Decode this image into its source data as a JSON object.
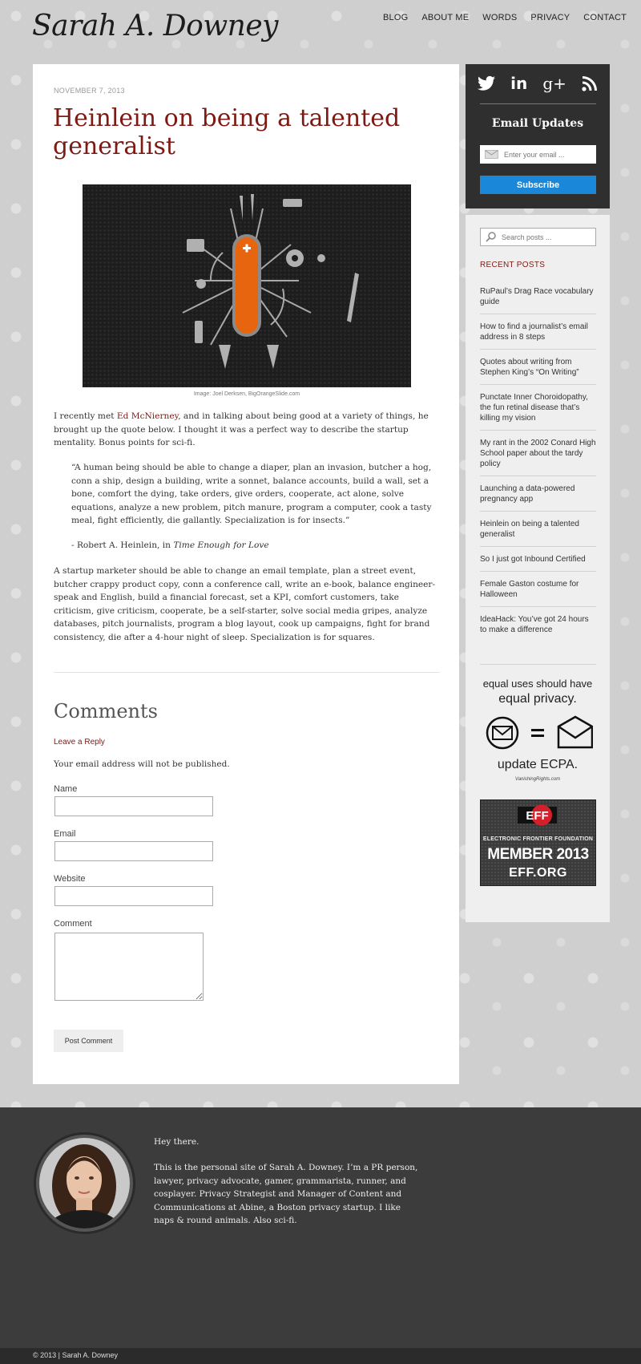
{
  "site": {
    "logo": "Sarah A. Downey"
  },
  "nav": {
    "items": [
      "BLOG",
      "ABOUT ME",
      "WORDS",
      "PRIVACY",
      "CONTACT"
    ]
  },
  "post": {
    "date": "NOVEMBER 7, 2013",
    "title": "Heinlein on being a talented generalist",
    "image_caption": "Image: Joel Derksen, BigOrangeSlide.com",
    "p1_before": "I recently met ",
    "p1_link": "Ed McNierney",
    "p1_after": ", and in talking about being good at a variety of things, he brought up the quote below. I thought it was a perfect way to describe the startup mentality. Bonus points for sci-fi.",
    "quote": "“A human being should be able to change a diaper, plan an invasion, butcher a hog, conn a ship, design a building, write a sonnet, balance accounts, build a wall, set a bone, comfort the dying, take orders, give orders, cooperate, act alone, solve equations, analyze a new problem, pitch manure, program a computer, cook a tasty meal, fight efficiently, die gallantly. Specialization is for insects.”",
    "attribution_prefix": "- Robert A. Heinlein, in ",
    "attribution_book": "Time Enough for Love",
    "p2": "A startup marketer should be able to change an email template, plan a street event, butcher crappy product copy, conn a conference call, write an e-book, balance engineer-speak and English, build a financial forecast, set a KPI, comfort customers, take criticism, give criticism, cooperate, be a self-starter, solve social media gripes, analyze databases, pitch journalists, program a blog layout, cook up campaigns, fight for brand consistency, die after a 4-hour night of sleep. Specialization is for squares."
  },
  "comments": {
    "heading": "Comments",
    "leave_reply": "Leave a Reply",
    "email_note": "Your email address will not be published.",
    "name_label": "Name",
    "email_label": "Email",
    "website_label": "Website",
    "comment_label": "Comment",
    "submit_label": "Post Comment"
  },
  "sidebar": {
    "social_icons": [
      "twitter-icon",
      "linkedin-icon",
      "google-plus-icon",
      "rss-icon"
    ],
    "social_glyphs": {
      "linkedin": "in",
      "google_plus": "g+"
    },
    "email_updates_heading": "Email Updates",
    "email_placeholder": "Enter your email ...",
    "subscribe_label": "Subscribe",
    "search_placeholder": "Search posts ...",
    "recent_posts_heading": "RECENT POSTS",
    "recent_posts": [
      "RuPaul’s Drag Race vocabulary guide",
      "How to find a journalist’s email address in 8 steps",
      "Quotes about writing from Stephen King’s “On Writing”",
      "Punctate Inner Choroidopathy, the fun retinal disease that’s killing my vision",
      "My rant in the 2002 Conard High School paper about the tardy policy",
      "Launching a data-powered pregnancy app",
      "Heinlein on being a talented generalist",
      "So I just got Inbound Certified",
      "Female Gaston costume for Halloween",
      "IdeaHack: You’ve got 24 hours to make a difference"
    ],
    "ecpa": {
      "line1": "equal uses should have",
      "line2": "equal privacy.",
      "line3": "update ECPA.",
      "source": "VanishingRights.com"
    },
    "eff": {
      "logo_text": "EFF",
      "line1": "ELECTRONIC FRONTIER FOUNDATION",
      "line2": "MEMBER 2013",
      "line3": "EFF.ORG"
    }
  },
  "footer": {
    "greeting": "Hey there.",
    "bio": "This is the personal site of Sarah A. Downey. I’m a PR person, lawyer, privacy advocate, gamer, grammarista, runner, and cosplayer. Privacy Strategist and Manager of Content and Communications at Abine, a Boston privacy startup. I like naps & round animals. Also sci-fi.",
    "copyright": "© 2013 | Sarah A. Downey"
  },
  "colors": {
    "accent": "#7d1a14",
    "subscribe_button": "#1a87d9",
    "sidebar_dark": "#2f2f2f",
    "footer": "#3c3c3c",
    "knife_orange": "#e8650f"
  }
}
